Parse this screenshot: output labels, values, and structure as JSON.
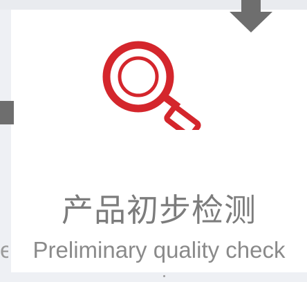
{
  "step": {
    "title_cn": "产品初步检测",
    "title_en": "Preliminary quality check",
    "edge_text": "e",
    "icon": "magnifier-icon"
  },
  "colors": {
    "icon_red": "#d4262c",
    "text_gray": "#7c7c7c",
    "arrow_gray": "#6e6e6e"
  }
}
